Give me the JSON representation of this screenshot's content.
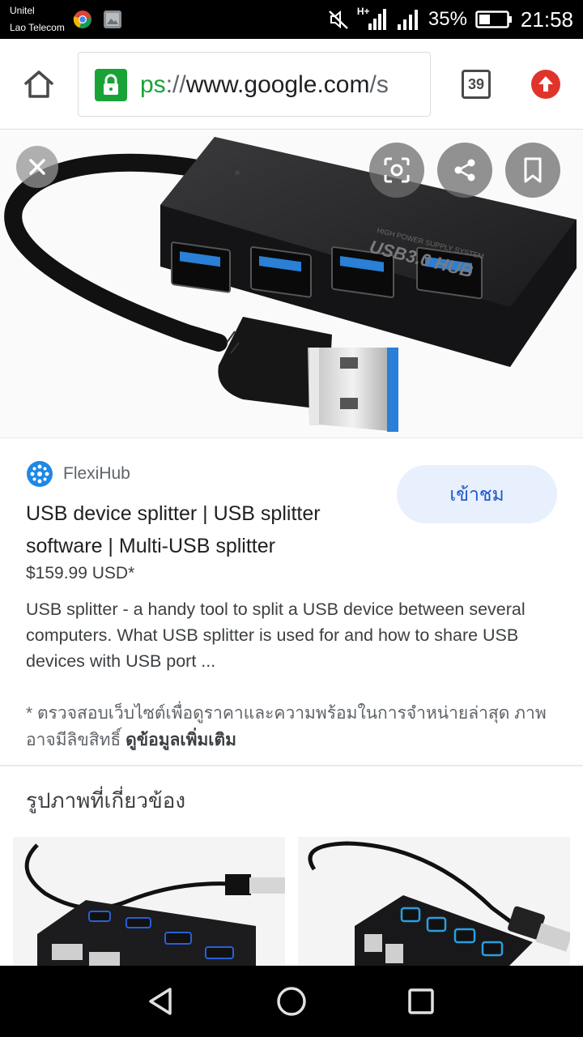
{
  "status_bar": {
    "carrier_1": "Unitel",
    "carrier_2": "Lao Telecom",
    "network": "H+",
    "battery": "35%",
    "time": "21:58"
  },
  "browser": {
    "url_scheme": "ps",
    "url_sep": "://",
    "url_host": "www.google.com",
    "url_tail": "/s",
    "tab_count": "39"
  },
  "result": {
    "source_name": "FlexiHub",
    "visit_label": "เข้าชม",
    "title": "USB device splitter | USB splitter software | Multi-USB splitter",
    "price": "$159.99 USD*",
    "snippet": "USB splitter - a handy tool to split a USB device between several computers. What USB splitter is used for and how to share USB devices with USB port ...",
    "disclaimer": "* ตรวจสอบเว็บไซต์เพื่อดูราคาและความพร้อมในการจำหน่ายล่าสุด ภาพอาจมีลิขสิทธิ์",
    "more_info_link": "ดูข้อมูลเพิ่มเติม"
  },
  "hero_product": {
    "label": "USB3.0 HUB",
    "sublabel": "HIGH POWER SUPPLY SYSTEM"
  },
  "related": {
    "heading": "รูปภาพที่เกี่ยวข้อง"
  },
  "colors": {
    "secure_green": "#19a337",
    "update_red": "#e0342b",
    "link_blue": "#1a56c9",
    "visit_bg": "#e8f0fe",
    "usb_blue": "#2a7fd6"
  }
}
